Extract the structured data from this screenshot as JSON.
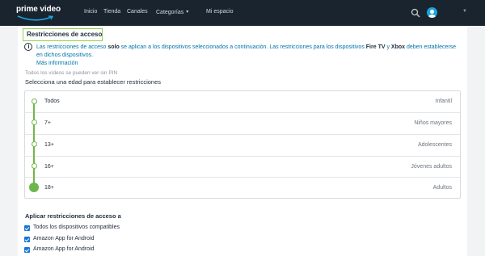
{
  "header": {
    "logo_text": "prime video",
    "nav": {
      "inicio": "Inicio",
      "tienda": "Tienda",
      "canales": "Canales",
      "categorias": "Categorías",
      "mi_espacio": "Mi espacio"
    },
    "icons": {
      "search": "search-icon",
      "caret": "chevron-down-icon",
      "avatar": "avatar"
    }
  },
  "page": {
    "title": "Restricciones de acceso",
    "info": {
      "part1": "Las restricciones de acceso ",
      "bold1": "solo",
      "part2": " se aplican a los dispositivos seleccionados a continuación. Las restricciones para los dispositivos ",
      "bold2": "Fire TV",
      "part3": " y ",
      "bold3": "Xbox",
      "part4": " deben establecerse en dichos dispositivos.",
      "link": "Más información"
    },
    "pin_note": "Todos los vídeos se pueden ver sin PIN",
    "select_label": "Selecciona una edad para establecer restricciones",
    "ages": [
      {
        "label": "Todos",
        "desc": "Infantil"
      },
      {
        "label": "7+",
        "desc": "Niños mayores"
      },
      {
        "label": "13+",
        "desc": "Adolescentes"
      },
      {
        "label": "16+",
        "desc": "Jóvenes adultos"
      },
      {
        "label": "18+",
        "desc": "Adultos"
      }
    ],
    "selected_age_index": 4,
    "apply_title": "Aplicar restricciones de acceso a",
    "devices": [
      {
        "label": "Todos los dispositivos compatibles",
        "checked": true
      },
      {
        "label": "Amazon App for Android",
        "checked": true
      },
      {
        "label": "Amazon App for Android",
        "checked": true
      }
    ]
  },
  "colors": {
    "header_bg": "#1a242f",
    "accent_green": "#70b84a",
    "link_blue": "#0073aa",
    "checkbox_blue": "#1976d2"
  }
}
